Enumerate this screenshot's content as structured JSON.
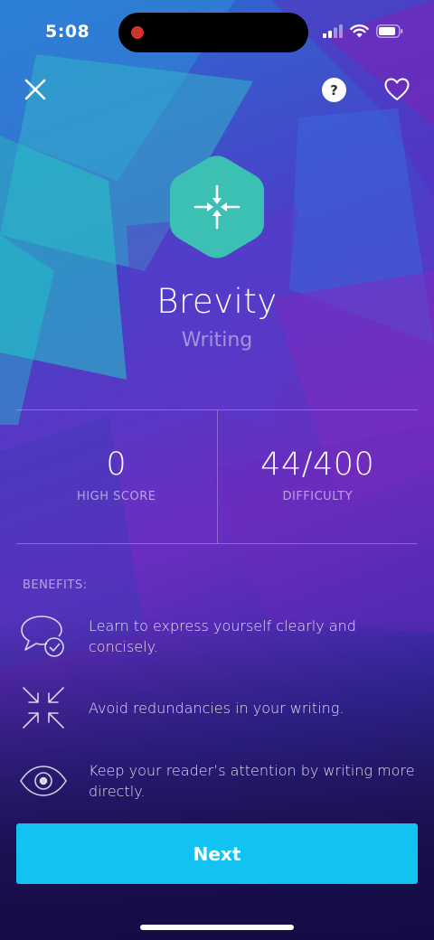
{
  "status_bar": {
    "time": "5:08"
  },
  "header": {
    "help_label": "?"
  },
  "game": {
    "title": "Brevity",
    "category": "Writing"
  },
  "stats": [
    {
      "value": "0",
      "label": "HIGH SCORE"
    },
    {
      "value": "44/400",
      "label": "DIFFICULTY"
    }
  ],
  "benefits": {
    "title": "BENEFITS:",
    "items": [
      {
        "icon": "speech-bubble-check-icon",
        "text": "Learn to express yourself clearly and concisely."
      },
      {
        "icon": "compress-arrows-icon",
        "text": "Avoid redundancies in your writing."
      },
      {
        "icon": "eye-icon",
        "text": "Keep your reader’s attention by writing more directly."
      }
    ]
  },
  "actions": {
    "next_label": "Next"
  },
  "colors": {
    "accent": "#12c3f2",
    "hero_tile": "#3cc0b4"
  }
}
